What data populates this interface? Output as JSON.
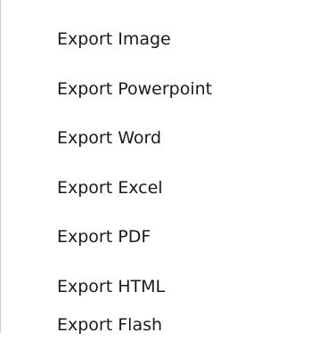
{
  "menu": {
    "items": [
      {
        "label": "Export Image"
      },
      {
        "label": "Export Powerpoint"
      },
      {
        "label": "Export Word"
      },
      {
        "label": "Export Excel"
      },
      {
        "label": "Export PDF"
      },
      {
        "label": "Export HTML"
      },
      {
        "label": "Export Flash"
      }
    ]
  }
}
